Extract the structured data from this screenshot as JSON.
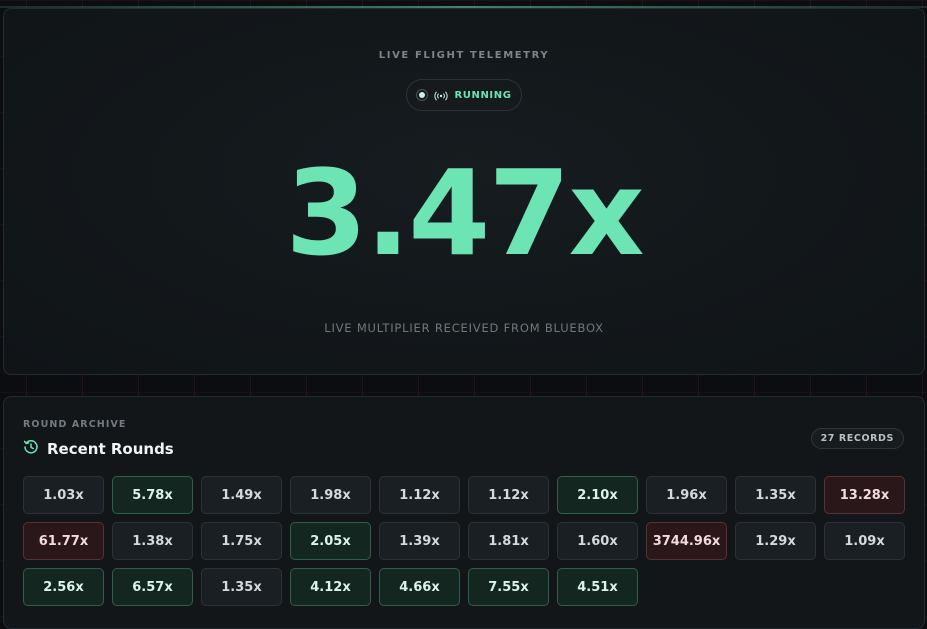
{
  "telemetry": {
    "eyebrow": "LIVE FLIGHT TELEMETRY",
    "status": "RUNNING",
    "multiplier": "3.47x",
    "caption": "LIVE MULTIPLIER RECEIVED FROM BLUEBOX"
  },
  "archive": {
    "eyebrow": "ROUND ARCHIVE",
    "title": "Recent Rounds",
    "records_badge": "27 RECORDS",
    "rounds": [
      {
        "value": "1.03x",
        "tone": "neutral"
      },
      {
        "value": "5.78x",
        "tone": "green"
      },
      {
        "value": "1.49x",
        "tone": "neutral"
      },
      {
        "value": "1.98x",
        "tone": "neutral"
      },
      {
        "value": "1.12x",
        "tone": "neutral"
      },
      {
        "value": "1.12x",
        "tone": "neutral"
      },
      {
        "value": "2.10x",
        "tone": "green"
      },
      {
        "value": "1.96x",
        "tone": "neutral"
      },
      {
        "value": "1.35x",
        "tone": "neutral"
      },
      {
        "value": "13.28x",
        "tone": "red"
      },
      {
        "value": "61.77x",
        "tone": "red"
      },
      {
        "value": "1.38x",
        "tone": "neutral"
      },
      {
        "value": "1.75x",
        "tone": "neutral"
      },
      {
        "value": "2.05x",
        "tone": "green"
      },
      {
        "value": "1.39x",
        "tone": "neutral"
      },
      {
        "value": "1.81x",
        "tone": "neutral"
      },
      {
        "value": "1.60x",
        "tone": "neutral"
      },
      {
        "value": "3744.96x",
        "tone": "red"
      },
      {
        "value": "1.29x",
        "tone": "neutral"
      },
      {
        "value": "1.09x",
        "tone": "neutral"
      },
      {
        "value": "2.56x",
        "tone": "green"
      },
      {
        "value": "6.57x",
        "tone": "green"
      },
      {
        "value": "1.35x",
        "tone": "neutral"
      },
      {
        "value": "4.12x",
        "tone": "green"
      },
      {
        "value": "4.66x",
        "tone": "green"
      },
      {
        "value": "7.55x",
        "tone": "green"
      },
      {
        "value": "4.51x",
        "tone": "green"
      }
    ]
  },
  "icons": {
    "status": "broadcast-icon",
    "archive": "history-icon"
  },
  "colors": {
    "accent": "#6ce4b4",
    "background": "#0b0d10",
    "panel": "#12171a",
    "chip_green": "#13261f",
    "chip_red": "#2a1719"
  }
}
